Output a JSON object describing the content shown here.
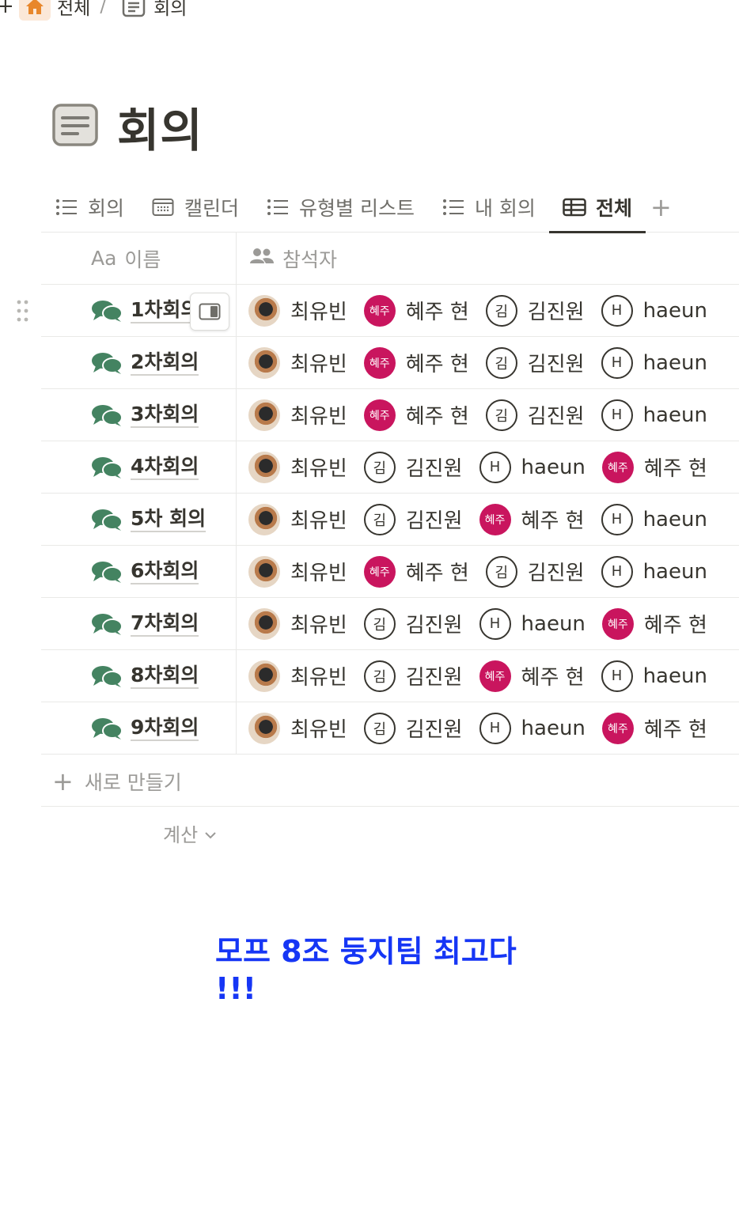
{
  "breadcrumb": {
    "plus": "+",
    "root": "전체",
    "separator": "/",
    "current": "회의"
  },
  "page": {
    "title": "회의"
  },
  "tabs": [
    {
      "label": "회의",
      "icon": "list-icon"
    },
    {
      "label": "캘린더",
      "icon": "calendar-icon"
    },
    {
      "label": "유형별 리스트",
      "icon": "list-icon"
    },
    {
      "label": "내 회의",
      "icon": "list-icon"
    },
    {
      "label": "전체",
      "icon": "table-icon",
      "active": true
    }
  ],
  "tab_add": "+",
  "table": {
    "col_name": {
      "prefix": "Aa",
      "label": "이름"
    },
    "col_attendees": "참석자",
    "rows": [
      {
        "title": "1차회의",
        "attendees": [
          "최유빈",
          "혜주 현",
          "김진원",
          "haeun"
        ]
      },
      {
        "title": "2차회의",
        "attendees": [
          "최유빈",
          "혜주 현",
          "김진원",
          "haeun"
        ]
      },
      {
        "title": "3차회의",
        "attendees": [
          "최유빈",
          "혜주 현",
          "김진원",
          "haeun"
        ]
      },
      {
        "title": "4차회의",
        "attendees": [
          "최유빈",
          "김진원",
          "haeun",
          "혜주 현"
        ]
      },
      {
        "title": "5차 회의",
        "attendees": [
          "최유빈",
          "김진원",
          "혜주 현",
          "haeun"
        ]
      },
      {
        "title": "6차회의",
        "attendees": [
          "최유빈",
          "혜주 현",
          "김진원",
          "haeun"
        ]
      },
      {
        "title": "7차회의",
        "attendees": [
          "최유빈",
          "김진원",
          "haeun",
          "혜주 현"
        ]
      },
      {
        "title": "8차회의",
        "attendees": [
          "최유빈",
          "김진원",
          "혜주 현",
          "haeun"
        ]
      },
      {
        "title": "9차회의",
        "attendees": [
          "최유빈",
          "김진원",
          "haeun",
          "혜주 현"
        ]
      }
    ]
  },
  "people": {
    "최유빈": {
      "avatar": "photo",
      "initial": ""
    },
    "혜주 현": {
      "avatar": "pink",
      "initial": "혜주"
    },
    "김진원": {
      "avatar": "outline",
      "initial": "김"
    },
    "haeun": {
      "avatar": "outline",
      "initial": "H"
    }
  },
  "new_row_label": "새로 만들기",
  "calc_label": "계산",
  "note": "모프 8조 둥지팀 최고다 !!!",
  "colors": {
    "accent_pink": "#c9155e",
    "note_blue": "#1636f5",
    "home_orange": "#e8872b",
    "chat_green": "#448361"
  }
}
